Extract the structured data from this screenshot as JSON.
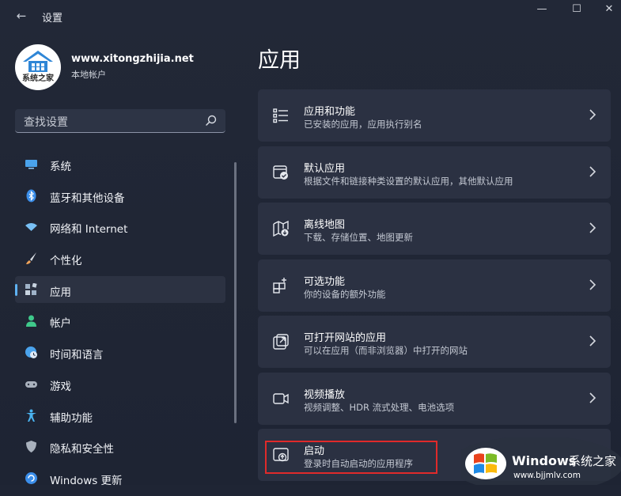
{
  "window": {
    "title": "设置",
    "back_glyph": "←",
    "controls": {
      "minimize": "—",
      "maximize": "☐",
      "close": "✕"
    }
  },
  "user": {
    "name": "www.xitongzhijia.net",
    "account_type": "本地帐户",
    "avatar_text": "系统之家"
  },
  "search": {
    "placeholder": "查找设置",
    "icon": "search-icon"
  },
  "sidebar": {
    "items": [
      {
        "label": "系统",
        "icon": "monitor-icon",
        "color": "#4aa3ec"
      },
      {
        "label": "蓝牙和其他设备",
        "icon": "bluetooth-icon",
        "color": "#3b8eea"
      },
      {
        "label": "网络和 Internet",
        "icon": "wifi-icon",
        "color": "#78c0f5"
      },
      {
        "label": "个性化",
        "icon": "brush-icon",
        "color": "#f0a35a"
      },
      {
        "label": "应用",
        "icon": "apps-icon",
        "color": "#9fb3c8",
        "active": true
      },
      {
        "label": "帐户",
        "icon": "person-icon",
        "color": "#3fc98b"
      },
      {
        "label": "时间和语言",
        "icon": "globe-clock-icon",
        "color": "#4aa3ec"
      },
      {
        "label": "游戏",
        "icon": "gamepad-icon",
        "color": "#a9b1bd"
      },
      {
        "label": "辅助功能",
        "icon": "accessibility-icon",
        "color": "#4ab3f0"
      },
      {
        "label": "隐私和安全性",
        "icon": "shield-icon",
        "color": "#a9b1bd"
      },
      {
        "label": "Windows 更新",
        "icon": "update-icon",
        "color": "#3b8eea"
      }
    ]
  },
  "main": {
    "title": "应用",
    "cards": [
      {
        "title": "应用和功能",
        "subtitle": "已安装的应用，应用执行别名",
        "icon": "list-icon"
      },
      {
        "title": "默认应用",
        "subtitle": "根据文件和链接种类设置的默认应用，其他默认应用",
        "icon": "default-apps-icon"
      },
      {
        "title": "离线地图",
        "subtitle": "下载、存储位置、地图更新",
        "icon": "offline-map-icon"
      },
      {
        "title": "可选功能",
        "subtitle": "你的设备的额外功能",
        "icon": "optional-features-icon"
      },
      {
        "title": "可打开网站的应用",
        "subtitle": "可以在应用（而非浏览器）中打开的网站",
        "icon": "open-link-icon"
      },
      {
        "title": "视频播放",
        "subtitle": "视频调整、HDR 流式处理、电池选项",
        "icon": "video-icon"
      },
      {
        "title": "启动",
        "subtitle": "登录时自动启动的应用程序",
        "icon": "startup-icon"
      }
    ]
  },
  "watermark": {
    "brand": "Windows",
    "brand_suffix": "系统之家",
    "url": "www.bjjmlv.com"
  },
  "colors": {
    "accent": "#5fb2f2",
    "highlight_box": "#e02a2a"
  }
}
